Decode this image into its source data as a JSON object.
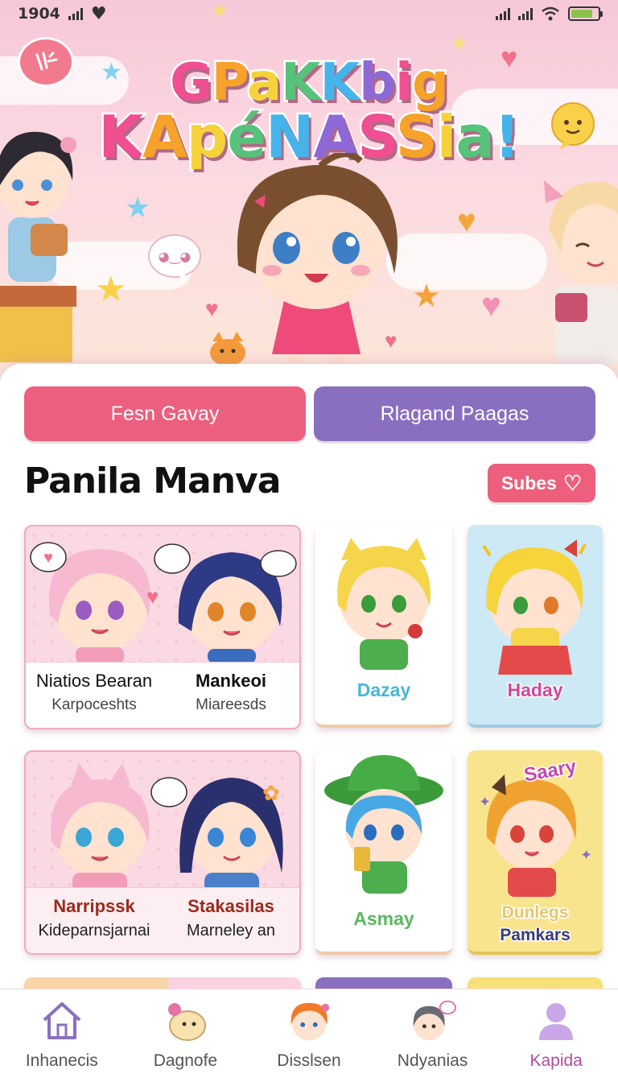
{
  "status_bar": {
    "time": "1904",
    "colors": {
      "battery": "#8bc34a"
    }
  },
  "hero": {
    "title_line1": "GPaKKbig",
    "title_line2": "KApéNASSia!",
    "title_colors": [
      "#f04f92",
      "#f7a22a",
      "#f6d23a",
      "#56c27a",
      "#45b4ea",
      "#8d68d6"
    ]
  },
  "tabs": [
    {
      "label": "Fesn Gavay",
      "color": "#ec5f7e"
    },
    {
      "label": "Rlagand Paagas",
      "color": "#8a6fc0"
    }
  ],
  "section": {
    "title": "Panila Manva",
    "subscribe_label": "Subes"
  },
  "cards": {
    "wide1": {
      "left_name": "Niatios Bearan",
      "left_sub": "Karpoceshts",
      "right_name": "Mankeoi",
      "right_sub": "Miareesds"
    },
    "tall1": {
      "label": "Dazay",
      "label_color": "#49b6d6"
    },
    "tall2": {
      "label": "Haday",
      "label_color": "#d0479c"
    },
    "wide2": {
      "left_name": "Narripssk",
      "left_sub": "Kideparnsjarnai",
      "right_name": "Stakasilas",
      "right_sub": "Marneley an"
    },
    "tall3": {
      "label": "Asmay",
      "label_color": "#5cb860"
    },
    "tall4": {
      "label_top": "Saary",
      "label": "Dunlegs",
      "label2": "Pamkars"
    }
  },
  "bottom_nav": [
    {
      "label": "Inhanecis",
      "icon": "home-icon"
    },
    {
      "label": "Dagnofe",
      "icon": "mascot-icon"
    },
    {
      "label": "Disslsen",
      "icon": "character-icon"
    },
    {
      "label": "Ndyanias",
      "icon": "character-chat-icon"
    },
    {
      "label": "Kapida",
      "icon": "profile-icon",
      "active": true
    }
  ]
}
